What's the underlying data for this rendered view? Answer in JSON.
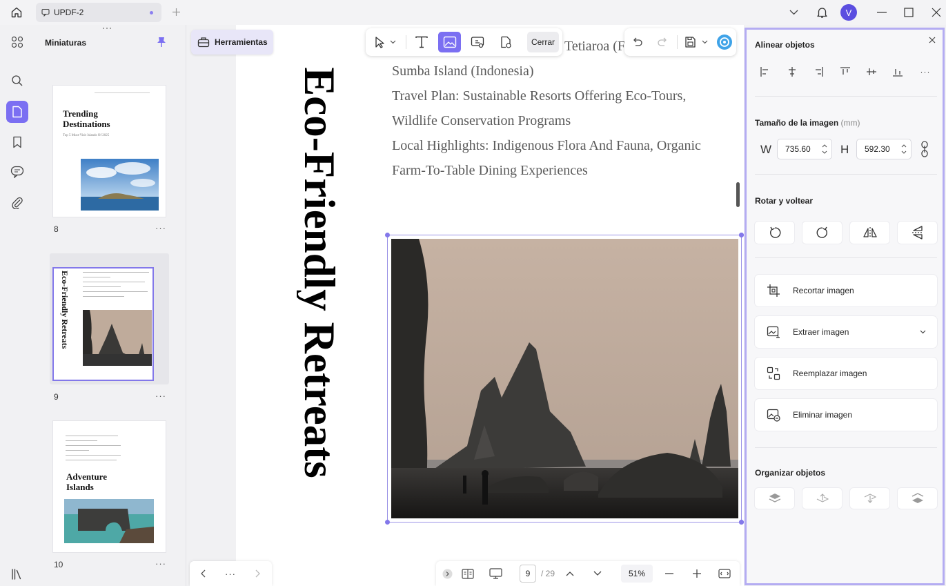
{
  "titlebar": {
    "tab_title": "UPDF-2"
  },
  "user": {
    "initial": "V"
  },
  "thumbnails": {
    "title": "Miniaturas",
    "pages": [
      {
        "num": "8",
        "heading": "Trending Destinations",
        "subtitle": "Top 5 Must-Visit Islands Of 2025",
        "more": "···"
      },
      {
        "num": "9",
        "heading": "Eco-Friendly Retreats",
        "more": "···"
      },
      {
        "num": "10",
        "heading": "Adventure Islands",
        "more": "···"
      }
    ]
  },
  "toolbar": {
    "tools_label": "Herramientas",
    "close_label": "Cerrar"
  },
  "document": {
    "vertical_title": "Eco-Friendly Retreats",
    "lines": [
      "Tetiaroa (F",
      "Sumba Island (Indonesia)",
      "Travel Plan: Sustainable Resorts Offering Eco-Tours,",
      "Wildlife Conservation Programs",
      "Local Highlights: Indigenous Flora And Fauna, Organic",
      "Farm-To-Table Dining Experiences"
    ]
  },
  "pagenav": {
    "more": "···"
  },
  "bottombar": {
    "current_page": "9",
    "total_pages": "/ 29",
    "zoom": "51%"
  },
  "panel": {
    "align_title": "Alinear objetos",
    "align_more": "···",
    "size_title": "Tamaño de la imagen",
    "size_unit": "(mm)",
    "w_label": "W",
    "w_value": "735.60",
    "h_label": "H",
    "h_value": "592.30",
    "rotate_title": "Rotar y voltear",
    "actions": [
      {
        "label": "Recortar imagen"
      },
      {
        "label": "Extraer imagen"
      },
      {
        "label": "Reemplazar imagen"
      },
      {
        "label": "Eliminar imagen"
      }
    ],
    "organize_title": "Organizar objetos"
  },
  "colors": {
    "accent": "#7b6ff2",
    "panel_border": "#b4acf2",
    "avatar": "#5b4ee0"
  }
}
